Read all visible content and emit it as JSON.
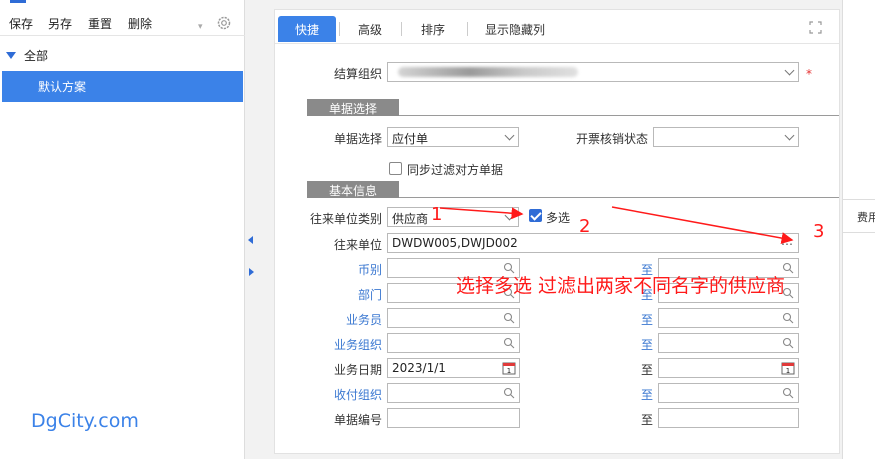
{
  "left_panel": {
    "toolbar": [
      "保存",
      "另存",
      "重置",
      "删除"
    ],
    "tree_root": "全部",
    "tree_selected": "默认方案",
    "watermark": "DgCity.com"
  },
  "tabs": [
    "快捷",
    "高级",
    "排序",
    "显示隐藏列"
  ],
  "form": {
    "settlement_org_label": "结算组织",
    "sections": [
      "单据选择",
      "基本信息"
    ],
    "doc_select_label": "单据选择",
    "doc_select_value": "应付单",
    "invoice_status_label": "开票核销状态",
    "sync_filter_label": "同步过滤对方单据",
    "partner_type_label": "往来单位类别",
    "partner_type_value": "供应商",
    "multi_select_label": "多选",
    "partner_label": "往来单位",
    "partner_value": "DWDW005,DWJD002",
    "currency_label": "币别",
    "dept_label": "部门",
    "salesman_label": "业务员",
    "biz_org_label": "业务组织",
    "biz_date_label": "业务日期",
    "biz_date_value": "2023/1/1",
    "pay_org_label": "收付组织",
    "doc_no_label": "单据编号",
    "to_label": "至",
    "required_mark": "*"
  },
  "annotations": {
    "n1": "1",
    "n2": "2",
    "n3": "3",
    "note": "选择多选  过滤出两家不同名字的供应商"
  },
  "right_tab": "费用",
  "colors": {
    "accent": "#3b82e8",
    "annotation": "#ff1a1a"
  }
}
